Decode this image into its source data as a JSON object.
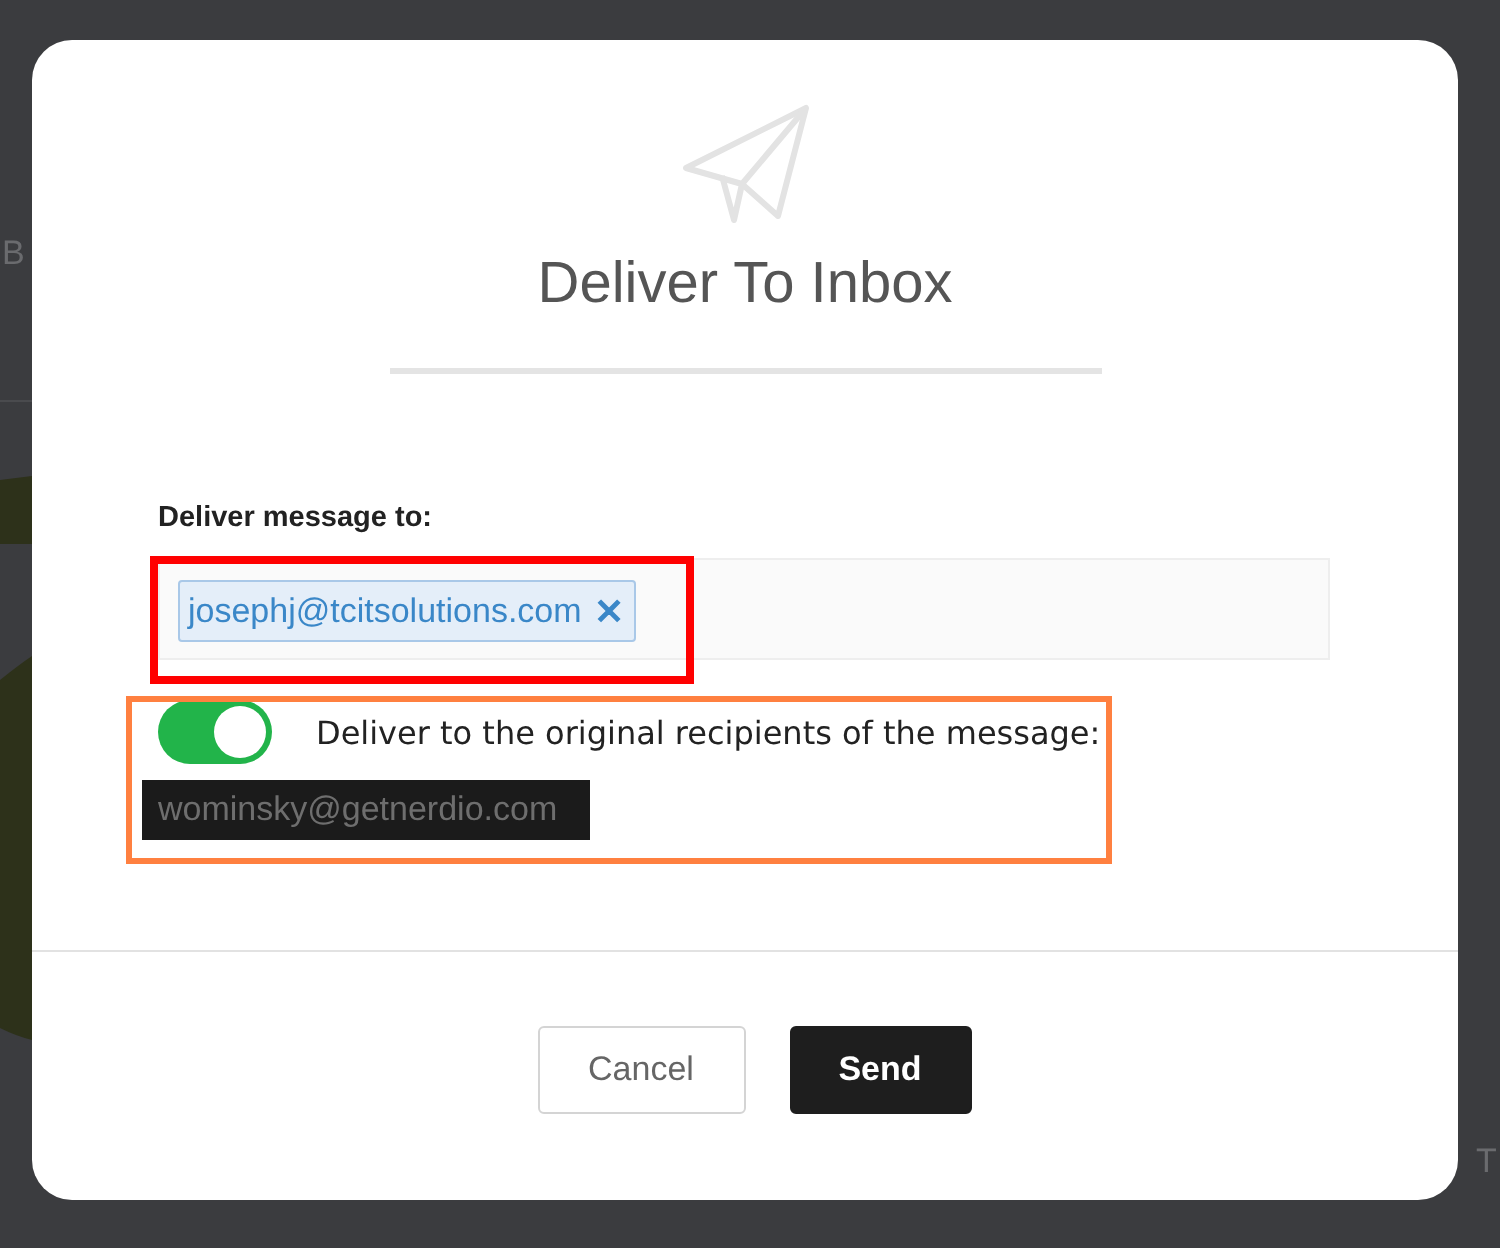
{
  "backdrop": {
    "fragments": [
      "B",
      "T"
    ]
  },
  "dialog": {
    "title": "Deliver To Inbox",
    "recipients_label": "Deliver message to:",
    "recipients": [
      {
        "address": "josephj@tcitsolutions.com",
        "remove": "✕"
      }
    ],
    "original_toggle": {
      "label": "Deliver to the original recipients of the message:",
      "on": true
    },
    "original_recipients": [
      "wominsky@getnerdio.com"
    ],
    "buttons": [
      {
        "label": "Cancel",
        "kind": "secondary"
      },
      {
        "label": "Send",
        "kind": "primary"
      }
    ]
  },
  "annotations": [
    {
      "color": "#ff0000"
    },
    {
      "color": "#ff8040"
    }
  ]
}
